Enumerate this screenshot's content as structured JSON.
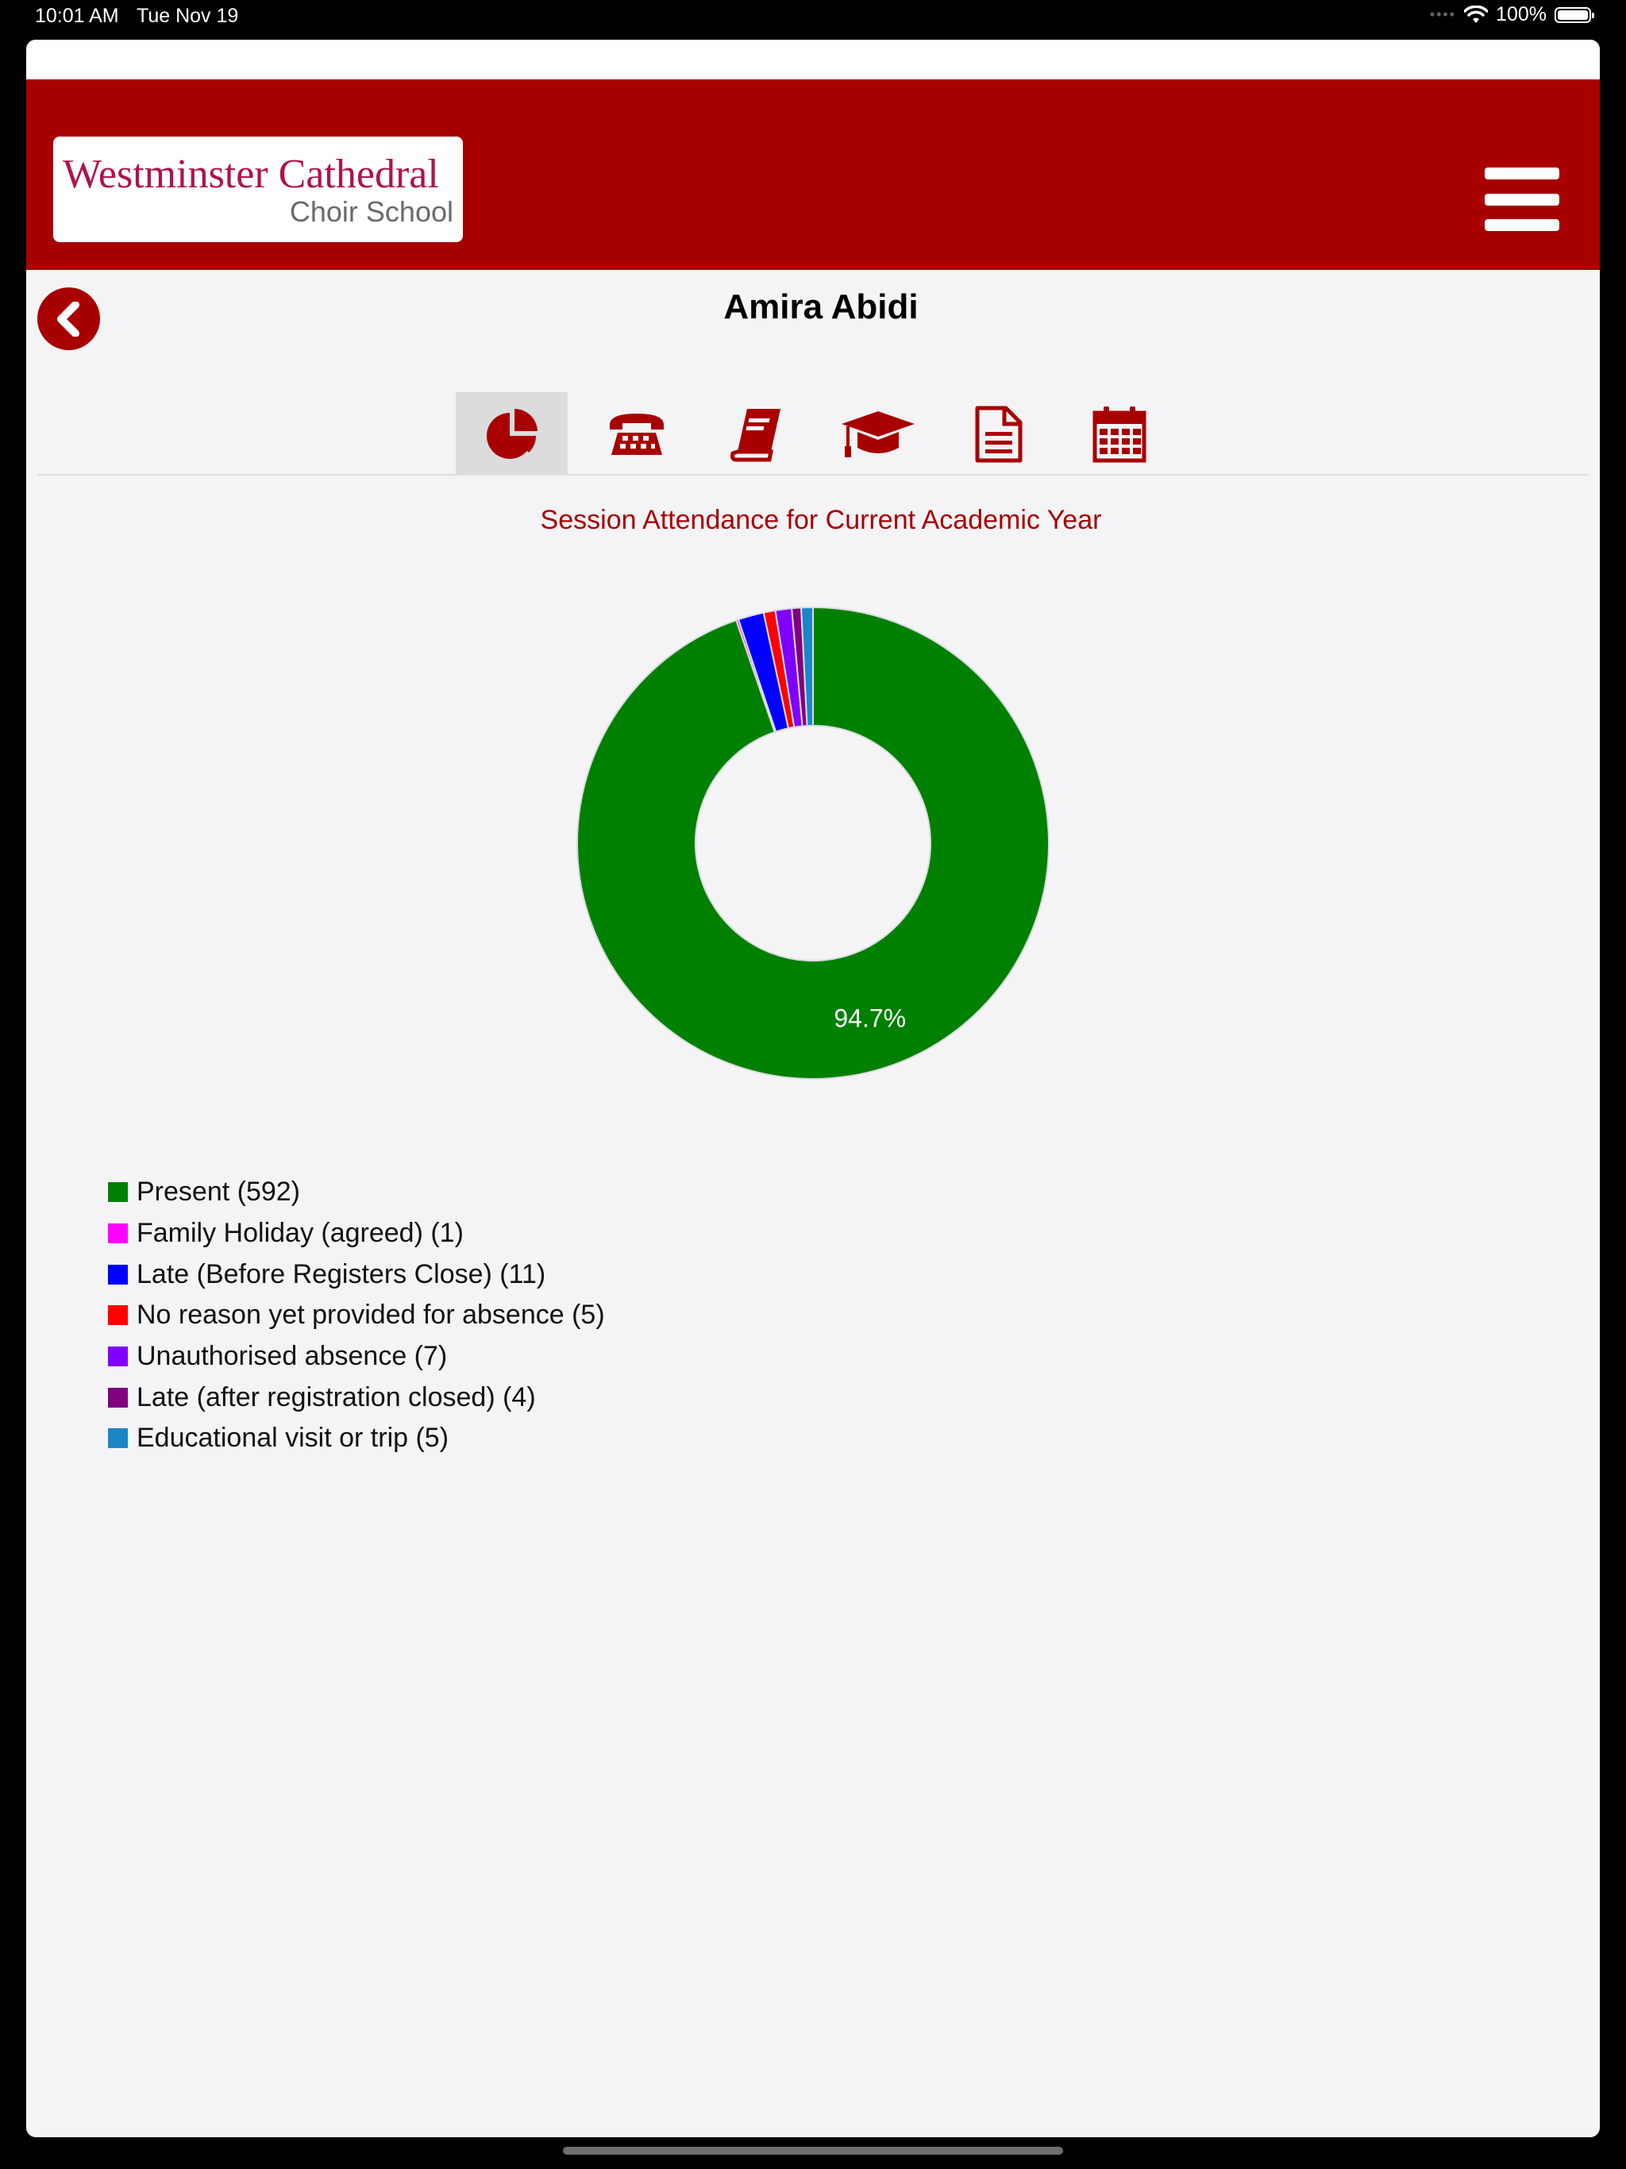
{
  "status_bar": {
    "time": "10:01 AM",
    "date": "Tue Nov 19",
    "battery": "100%",
    "battery_level": 1.0
  },
  "header": {
    "logo_line1": "Westminster Cathedral",
    "logo_line2": "Choir School",
    "brand_color": "#a80000",
    "menu_icon": "hamburger-menu-icon"
  },
  "page": {
    "student_name": "Amira Abidi",
    "back_icon": "chevron-left-icon"
  },
  "tabs": [
    {
      "icon": "pie-chart-icon",
      "active": true
    },
    {
      "icon": "telephone-icon",
      "active": false
    },
    {
      "icon": "book-icon",
      "active": false
    },
    {
      "icon": "graduation-cap-icon",
      "active": false
    },
    {
      "icon": "document-icon",
      "active": false
    },
    {
      "icon": "calendar-icon",
      "active": false
    }
  ],
  "chart_data": {
    "type": "pie",
    "title": "Session Attendance for Current Academic Year",
    "hole": true,
    "legend_position": "bottom-left",
    "label_shown": "94.7%",
    "slices": [
      {
        "label": "Present (592)",
        "value": 592,
        "color": "#008000"
      },
      {
        "label": "Family Holiday (agreed) (1)",
        "value": 1,
        "color": "#ff00ff"
      },
      {
        "label": "Late (Before Registers Close) (11)",
        "value": 11,
        "color": "#0000ff"
      },
      {
        "label": "No reason yet provided for absence (5)",
        "value": 5,
        "color": "#ff0000"
      },
      {
        "label": "Unauthorised absence (7)",
        "value": 7,
        "color": "#8000ff"
      },
      {
        "label": "Late (after registration closed) (4)",
        "value": 4,
        "color": "#800080"
      },
      {
        "label": "Educational visit or trip (5)",
        "value": 5,
        "color": "#1a86c7"
      }
    ]
  }
}
